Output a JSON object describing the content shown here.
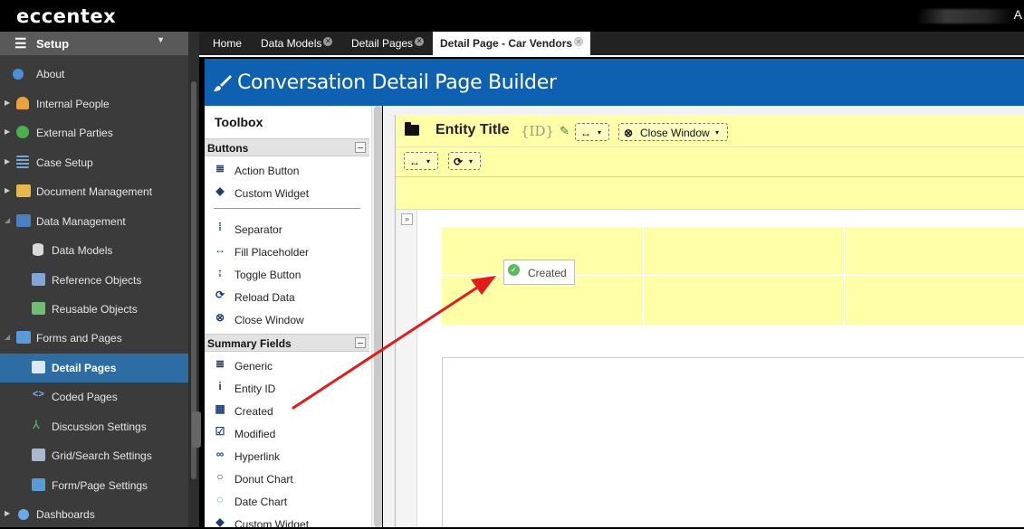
{
  "app": {
    "logo": "eccentex"
  },
  "sidebar": {
    "header": "Setup",
    "items": [
      {
        "label": "About"
      },
      {
        "label": "Internal People"
      },
      {
        "label": "External Parties"
      },
      {
        "label": "Case Setup"
      },
      {
        "label": "Document Management"
      },
      {
        "label": "Data Management"
      },
      {
        "label": "Data Models"
      },
      {
        "label": "Reference Objects"
      },
      {
        "label": "Reusable Objects"
      },
      {
        "label": "Forms and Pages"
      },
      {
        "label": "Detail Pages"
      },
      {
        "label": "Coded Pages"
      },
      {
        "label": "Discussion Settings"
      },
      {
        "label": "Grid/Search Settings"
      },
      {
        "label": "Form/Page Settings"
      },
      {
        "label": "Dashboards"
      }
    ]
  },
  "tabs": [
    {
      "label": "Home"
    },
    {
      "label": "Data Models"
    },
    {
      "label": "Detail Pages"
    },
    {
      "label": "Detail Page - Car Vendors"
    }
  ],
  "page": {
    "title": "Conversation Detail Page Builder"
  },
  "toolbox": {
    "title": "Toolbox",
    "sections": {
      "buttons": "Buttons",
      "summary": "Summary Fields"
    },
    "buttons": [
      {
        "label": "Action Button",
        "icon": "database-icon"
      },
      {
        "label": "Custom Widget",
        "icon": "tag-icon"
      },
      {
        "label": "Separator",
        "icon": "separator-icon"
      },
      {
        "label": "Fill Placeholder",
        "icon": "arrows-h-icon"
      },
      {
        "label": "Toggle Button",
        "icon": "toggle-icon"
      },
      {
        "label": "Reload Data",
        "icon": "refresh-icon"
      },
      {
        "label": "Close Window",
        "icon": "close-circle-icon"
      }
    ],
    "summary": [
      {
        "label": "Generic",
        "icon": "database-icon"
      },
      {
        "label": "Entity ID",
        "icon": "info-icon"
      },
      {
        "label": "Created",
        "icon": "calendar-icon"
      },
      {
        "label": "Modified",
        "icon": "calendar-check-icon"
      },
      {
        "label": "Hyperlink",
        "icon": "link-icon"
      },
      {
        "label": "Donut Chart",
        "icon": "circle-icon"
      },
      {
        "label": "Date Chart",
        "icon": "circle-notch-icon"
      },
      {
        "label": "Custom Widget",
        "icon": "tag-icon"
      }
    ]
  },
  "canvas": {
    "entity_title": "Entity Title",
    "entity_id": "{ID}",
    "close_window": "Close Window",
    "created_chip": "Created",
    "expand_glyph": "»"
  },
  "colors": {
    "header_blue": "#0d61b0",
    "active_nav": "#2e6da4",
    "highlight_yellow": "#ffffa8",
    "arrow_red": "#e31b1b"
  }
}
